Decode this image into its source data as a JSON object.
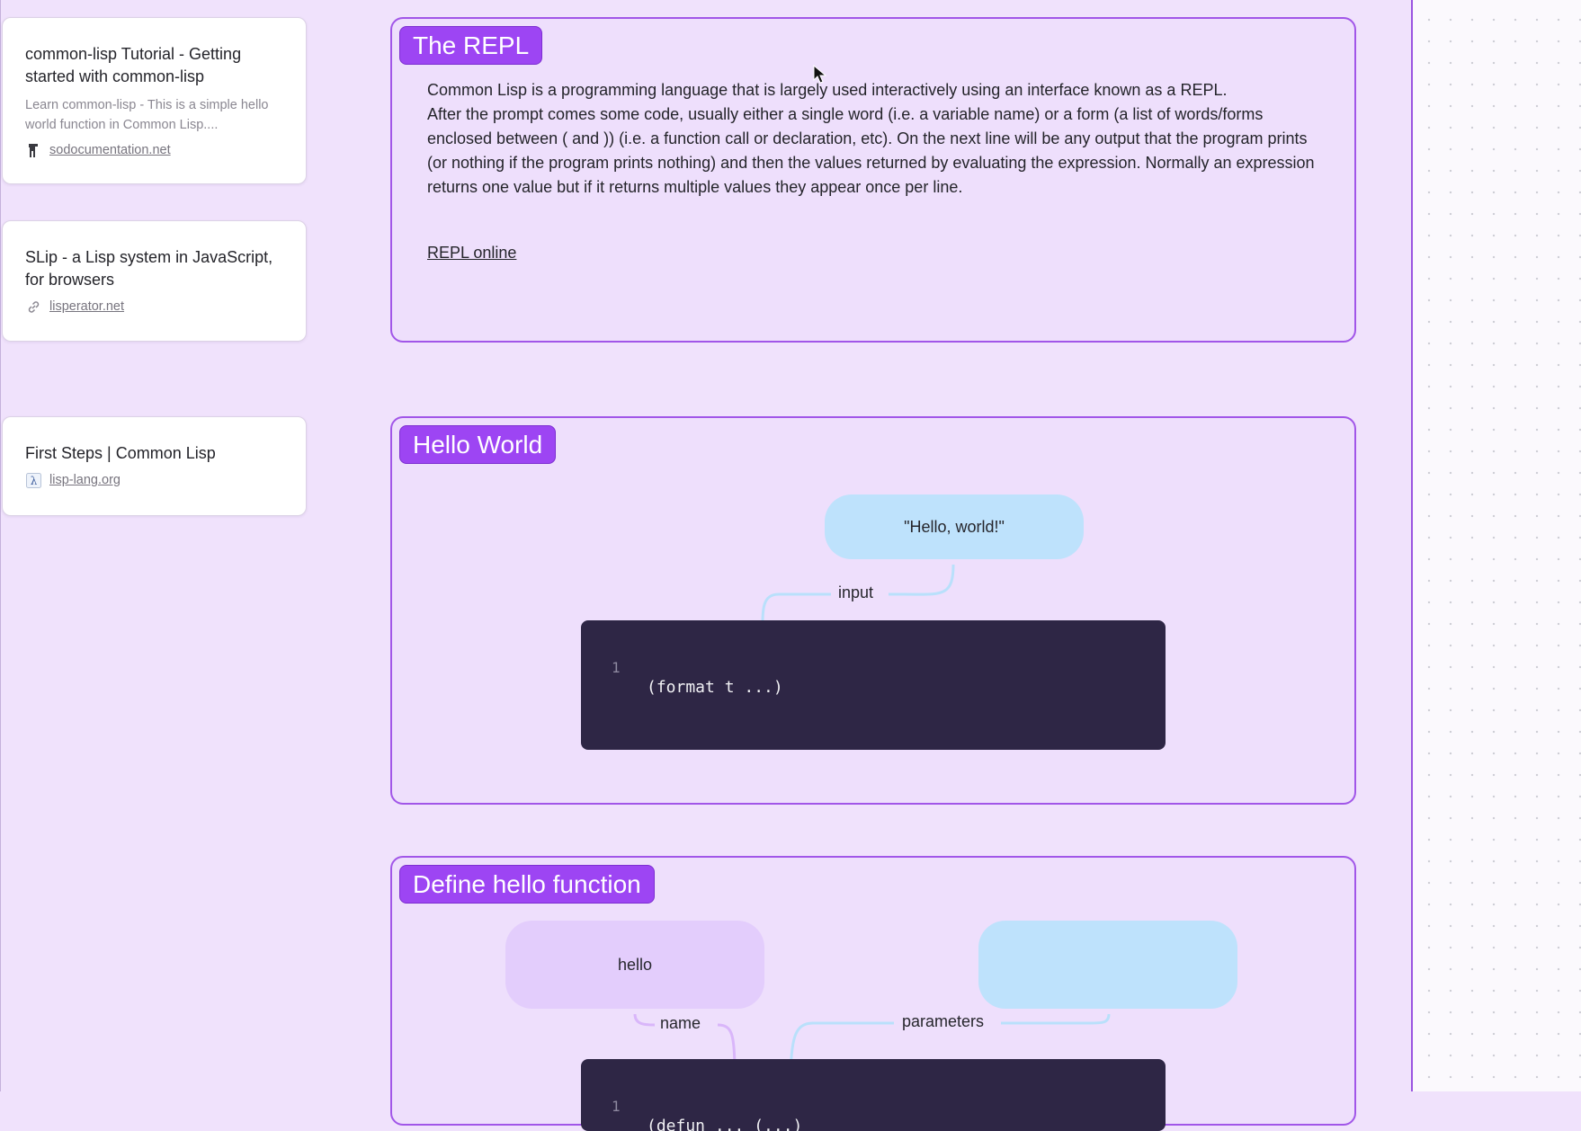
{
  "cards": [
    {
      "title": "common-lisp Tutorial - Getting started with common-lisp",
      "description": "Learn common-lisp - This is a simple hello world function in Common Lisp....",
      "source": "sodocumentation.net",
      "icon": "so-documentation-icon"
    },
    {
      "title": "SLip - a Lisp system in JavaScript, for browsers",
      "source": "lisperator.net",
      "icon": "link-icon"
    },
    {
      "title": "First Steps | Common Lisp",
      "source": "lisp-lang.org",
      "icon": "lambda-icon"
    }
  ],
  "sections": {
    "repl": {
      "title": "The REPL",
      "paragraph1": "Common Lisp is a programming language that is largely used interactively using an interface known as a REPL.",
      "paragraph2": "After the prompt comes some code, usually either a single word (i.e. a variable name) or a form (a list of words/forms enclosed between ( and )) (i.e. a function call or declaration, etc). On the next line will be any output that the program prints (or nothing if the program prints nothing) and then the values returned by evaluating the expression. Normally an expression returns one value but if it returns multiple values they appear once per line.",
      "link": "REPL online"
    },
    "hello_world": {
      "title": "Hello World",
      "node": "\"Hello, world!\"",
      "edge_label": "input",
      "code_line_no": "1",
      "code": "(format t ...)"
    },
    "define_hello": {
      "title": "Define hello function",
      "node_name": "hello",
      "node_params": "",
      "edge_name": "name",
      "edge_params": "parameters",
      "code_line_no": "1",
      "code": "(defun ... (...)"
    }
  },
  "colors": {
    "canvas": "#f0e2fc",
    "section_border": "#a156e8",
    "title_badge": "#9d45f3",
    "blue_node": "#bee2fc",
    "violet_node": "#e3cdfc",
    "code_bg": "#2e2645",
    "blue_edge": "#b9e0fb",
    "violet_edge": "#d9b6fa"
  }
}
